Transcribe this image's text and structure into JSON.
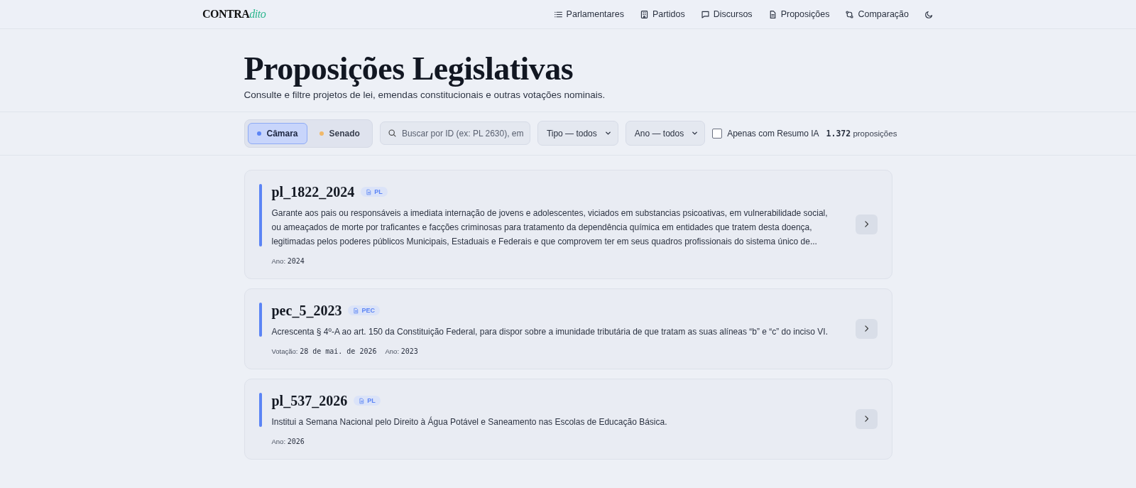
{
  "header": {
    "logo": {
      "strong": "CONTRA",
      "accent": "dito"
    },
    "nav": [
      {
        "label": "Parlamentares"
      },
      {
        "label": "Partidos"
      },
      {
        "label": "Discursos"
      },
      {
        "label": "Proposições"
      },
      {
        "label": "Comparação"
      }
    ]
  },
  "page": {
    "title": "Proposições Legislativas",
    "subtitle": "Consulte e filtre projetos de lei, emendas constitucionais e outras votações nominais."
  },
  "filters": {
    "houses": [
      {
        "label": "Câmara",
        "selected": true,
        "color": "#5b84f5"
      },
      {
        "label": "Senado",
        "selected": false,
        "color": "#f0b86a"
      }
    ],
    "search": {
      "placeholder": "Buscar por ID (ex: PL 2630), em"
    },
    "selects": [
      {
        "value": "Tipo — todos"
      },
      {
        "value": "Ano — todos"
      }
    ],
    "ai_only": {
      "label": "Apenas com Resumo IA",
      "checked": false
    },
    "count": {
      "number": "1.372",
      "label": "proposições"
    }
  },
  "propositions": [
    {
      "id": "pl_1822_2024",
      "type": "PL",
      "description": "Garante aos pais ou responsáveis a imediata internação de jovens e adolescentes, viciados em substancias psicoativas, em vulnerabilidade social, ou ameaçados de morte por traficantes e facções criminosas para tratamento da dependência química em entidades que tratem desta doença, legitimadas pelos poderes públicos Municipais, Estaduais e Federais e que comprovem ter em seus quadros profissionais do sistema único de...",
      "meta": [
        {
          "label": "Ano:",
          "value": "2024"
        }
      ]
    },
    {
      "id": "pec_5_2023",
      "type": "PEC",
      "description": "Acrescenta § 4º-A ao art. 150 da Constituição Federal, para dispor sobre a imunidade tributária de que tratam as suas alíneas “b” e “c” do inciso VI.",
      "meta": [
        {
          "label": "Votação:",
          "value": "28 de mai. de 2026"
        },
        {
          "label": "Ano:",
          "value": "2023"
        }
      ]
    },
    {
      "id": "pl_537_2026",
      "type": "PL",
      "description": "Institui a Semana Nacional pelo Direito à Água Potável e Saneamento nas Escolas de Educação Básica.",
      "meta": [
        {
          "label": "Ano:",
          "value": "2026"
        }
      ]
    }
  ]
}
